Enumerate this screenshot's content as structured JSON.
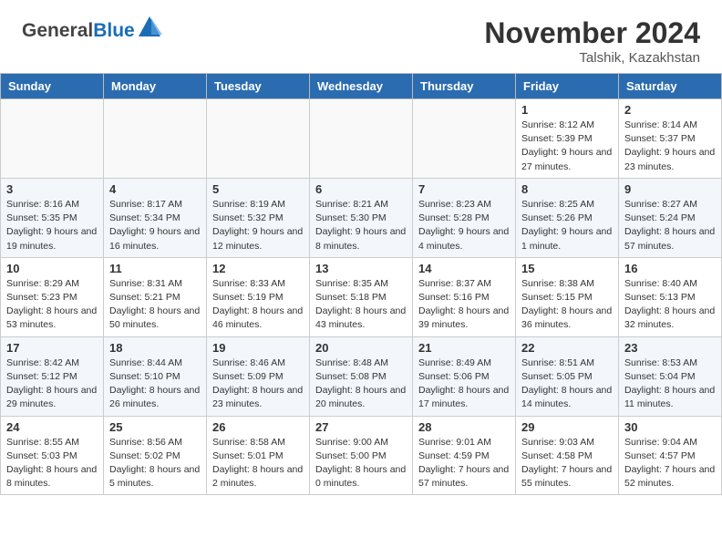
{
  "header": {
    "logo_general": "General",
    "logo_blue": "Blue",
    "month_year": "November 2024",
    "location": "Talshik, Kazakhstan"
  },
  "weekdays": [
    "Sunday",
    "Monday",
    "Tuesday",
    "Wednesday",
    "Thursday",
    "Friday",
    "Saturday"
  ],
  "weeks": [
    [
      {
        "day": "",
        "sunrise": "",
        "sunset": "",
        "daylight": ""
      },
      {
        "day": "",
        "sunrise": "",
        "sunset": "",
        "daylight": ""
      },
      {
        "day": "",
        "sunrise": "",
        "sunset": "",
        "daylight": ""
      },
      {
        "day": "",
        "sunrise": "",
        "sunset": "",
        "daylight": ""
      },
      {
        "day": "",
        "sunrise": "",
        "sunset": "",
        "daylight": ""
      },
      {
        "day": "1",
        "sunrise": "Sunrise: 8:12 AM",
        "sunset": "Sunset: 5:39 PM",
        "daylight": "Daylight: 9 hours and 27 minutes."
      },
      {
        "day": "2",
        "sunrise": "Sunrise: 8:14 AM",
        "sunset": "Sunset: 5:37 PM",
        "daylight": "Daylight: 9 hours and 23 minutes."
      }
    ],
    [
      {
        "day": "3",
        "sunrise": "Sunrise: 8:16 AM",
        "sunset": "Sunset: 5:35 PM",
        "daylight": "Daylight: 9 hours and 19 minutes."
      },
      {
        "day": "4",
        "sunrise": "Sunrise: 8:17 AM",
        "sunset": "Sunset: 5:34 PM",
        "daylight": "Daylight: 9 hours and 16 minutes."
      },
      {
        "day": "5",
        "sunrise": "Sunrise: 8:19 AM",
        "sunset": "Sunset: 5:32 PM",
        "daylight": "Daylight: 9 hours and 12 minutes."
      },
      {
        "day": "6",
        "sunrise": "Sunrise: 8:21 AM",
        "sunset": "Sunset: 5:30 PM",
        "daylight": "Daylight: 9 hours and 8 minutes."
      },
      {
        "day": "7",
        "sunrise": "Sunrise: 8:23 AM",
        "sunset": "Sunset: 5:28 PM",
        "daylight": "Daylight: 9 hours and 4 minutes."
      },
      {
        "day": "8",
        "sunrise": "Sunrise: 8:25 AM",
        "sunset": "Sunset: 5:26 PM",
        "daylight": "Daylight: 9 hours and 1 minute."
      },
      {
        "day": "9",
        "sunrise": "Sunrise: 8:27 AM",
        "sunset": "Sunset: 5:24 PM",
        "daylight": "Daylight: 8 hours and 57 minutes."
      }
    ],
    [
      {
        "day": "10",
        "sunrise": "Sunrise: 8:29 AM",
        "sunset": "Sunset: 5:23 PM",
        "daylight": "Daylight: 8 hours and 53 minutes."
      },
      {
        "day": "11",
        "sunrise": "Sunrise: 8:31 AM",
        "sunset": "Sunset: 5:21 PM",
        "daylight": "Daylight: 8 hours and 50 minutes."
      },
      {
        "day": "12",
        "sunrise": "Sunrise: 8:33 AM",
        "sunset": "Sunset: 5:19 PM",
        "daylight": "Daylight: 8 hours and 46 minutes."
      },
      {
        "day": "13",
        "sunrise": "Sunrise: 8:35 AM",
        "sunset": "Sunset: 5:18 PM",
        "daylight": "Daylight: 8 hours and 43 minutes."
      },
      {
        "day": "14",
        "sunrise": "Sunrise: 8:37 AM",
        "sunset": "Sunset: 5:16 PM",
        "daylight": "Daylight: 8 hours and 39 minutes."
      },
      {
        "day": "15",
        "sunrise": "Sunrise: 8:38 AM",
        "sunset": "Sunset: 5:15 PM",
        "daylight": "Daylight: 8 hours and 36 minutes."
      },
      {
        "day": "16",
        "sunrise": "Sunrise: 8:40 AM",
        "sunset": "Sunset: 5:13 PM",
        "daylight": "Daylight: 8 hours and 32 minutes."
      }
    ],
    [
      {
        "day": "17",
        "sunrise": "Sunrise: 8:42 AM",
        "sunset": "Sunset: 5:12 PM",
        "daylight": "Daylight: 8 hours and 29 minutes."
      },
      {
        "day": "18",
        "sunrise": "Sunrise: 8:44 AM",
        "sunset": "Sunset: 5:10 PM",
        "daylight": "Daylight: 8 hours and 26 minutes."
      },
      {
        "day": "19",
        "sunrise": "Sunrise: 8:46 AM",
        "sunset": "Sunset: 5:09 PM",
        "daylight": "Daylight: 8 hours and 23 minutes."
      },
      {
        "day": "20",
        "sunrise": "Sunrise: 8:48 AM",
        "sunset": "Sunset: 5:08 PM",
        "daylight": "Daylight: 8 hours and 20 minutes."
      },
      {
        "day": "21",
        "sunrise": "Sunrise: 8:49 AM",
        "sunset": "Sunset: 5:06 PM",
        "daylight": "Daylight: 8 hours and 17 minutes."
      },
      {
        "day": "22",
        "sunrise": "Sunrise: 8:51 AM",
        "sunset": "Sunset: 5:05 PM",
        "daylight": "Daylight: 8 hours and 14 minutes."
      },
      {
        "day": "23",
        "sunrise": "Sunrise: 8:53 AM",
        "sunset": "Sunset: 5:04 PM",
        "daylight": "Daylight: 8 hours and 11 minutes."
      }
    ],
    [
      {
        "day": "24",
        "sunrise": "Sunrise: 8:55 AM",
        "sunset": "Sunset: 5:03 PM",
        "daylight": "Daylight: 8 hours and 8 minutes."
      },
      {
        "day": "25",
        "sunrise": "Sunrise: 8:56 AM",
        "sunset": "Sunset: 5:02 PM",
        "daylight": "Daylight: 8 hours and 5 minutes."
      },
      {
        "day": "26",
        "sunrise": "Sunrise: 8:58 AM",
        "sunset": "Sunset: 5:01 PM",
        "daylight": "Daylight: 8 hours and 2 minutes."
      },
      {
        "day": "27",
        "sunrise": "Sunrise: 9:00 AM",
        "sunset": "Sunset: 5:00 PM",
        "daylight": "Daylight: 8 hours and 0 minutes."
      },
      {
        "day": "28",
        "sunrise": "Sunrise: 9:01 AM",
        "sunset": "Sunset: 4:59 PM",
        "daylight": "Daylight: 7 hours and 57 minutes."
      },
      {
        "day": "29",
        "sunrise": "Sunrise: 9:03 AM",
        "sunset": "Sunset: 4:58 PM",
        "daylight": "Daylight: 7 hours and 55 minutes."
      },
      {
        "day": "30",
        "sunrise": "Sunrise: 9:04 AM",
        "sunset": "Sunset: 4:57 PM",
        "daylight": "Daylight: 7 hours and 52 minutes."
      }
    ]
  ]
}
